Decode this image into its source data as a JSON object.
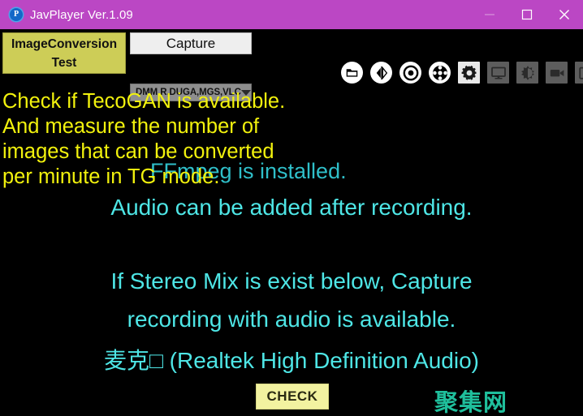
{
  "window": {
    "title": "JavPlayer Ver.1.09",
    "app_icon": "javplayer-logo-icon",
    "titlebar_color": "#bb47c4",
    "background_color": "#000000",
    "minimize_label": "minimize-icon",
    "maximize_label": "maximize-icon",
    "close_label": "close-icon"
  },
  "toolbar": {
    "image_conversion_test": {
      "line1": "ImageConversion",
      "line2": "Test",
      "color": "#cdcd57"
    },
    "capture_button": "Capture",
    "capture_select": {
      "value": "DMM,R,DUGA,MGS,VLC",
      "caret": "chevron-down-icon"
    },
    "icons": [
      {
        "name": "folder-icon",
        "style": "round"
      },
      {
        "name": "mirror-flip-icon",
        "style": "round"
      },
      {
        "name": "record-icon",
        "style": "round"
      },
      {
        "name": "disc-icon",
        "style": "round"
      },
      {
        "name": "gear-icon",
        "style": "square-active"
      },
      {
        "name": "monitor-icon",
        "style": "square"
      },
      {
        "name": "contrast-icon",
        "style": "square"
      },
      {
        "name": "video-camera-icon",
        "style": "square"
      },
      {
        "name": "image-effect-icon",
        "style": "square"
      }
    ]
  },
  "messages": {
    "yellow_note": "Check if TecoGAN is available.\nAnd measure the number of\nimages that can be converted\nper minute in TG mode.",
    "yellow_color": "#f2f20d",
    "ffmpeg_status": "FFmpeg is installed.",
    "ffmpeg_color": "#2fbfc9",
    "audio_note": "Audio can be added after recording.",
    "stereo_mix_line1": "If Stereo Mix is exist below, Capture",
    "stereo_mix_line2": "recording with audio is available.",
    "device_name": "麦克□ (Realtek High Definition Audio)",
    "cyan_color": "#4ee6e6"
  },
  "actions": {
    "check_button": "CHECK",
    "check_color": "#f2f2a0"
  },
  "watermark": {
    "text": "聚集网",
    "color": "#1fbf9c"
  }
}
